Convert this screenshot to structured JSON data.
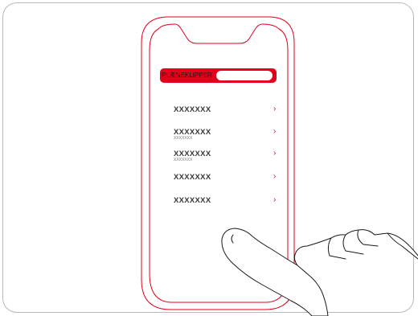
{
  "search": {
    "label": "PLÆNEKLIPPER",
    "value": ""
  },
  "list": {
    "items": [
      {
        "title": "XXXXXXX",
        "subtitle": "",
        "chevron": "›"
      },
      {
        "title": "XXXXXXX",
        "subtitle": "XXXXXXX",
        "chevron": "›"
      },
      {
        "title": "XXXXXXX",
        "subtitle": "XXXXXXX",
        "chevron": "›"
      },
      {
        "title": "XXXXXXX",
        "subtitle": "",
        "chevron": "›"
      },
      {
        "title": "XXXXXXX",
        "subtitle": "",
        "chevron": "›"
      }
    ]
  },
  "icons": {
    "hand": "pointing-hand-icon",
    "chevron": "chevron-right-icon"
  },
  "colors": {
    "accent": "#e3001b",
    "outline": "#1a1a1a",
    "frame": "#b9b9b9"
  }
}
